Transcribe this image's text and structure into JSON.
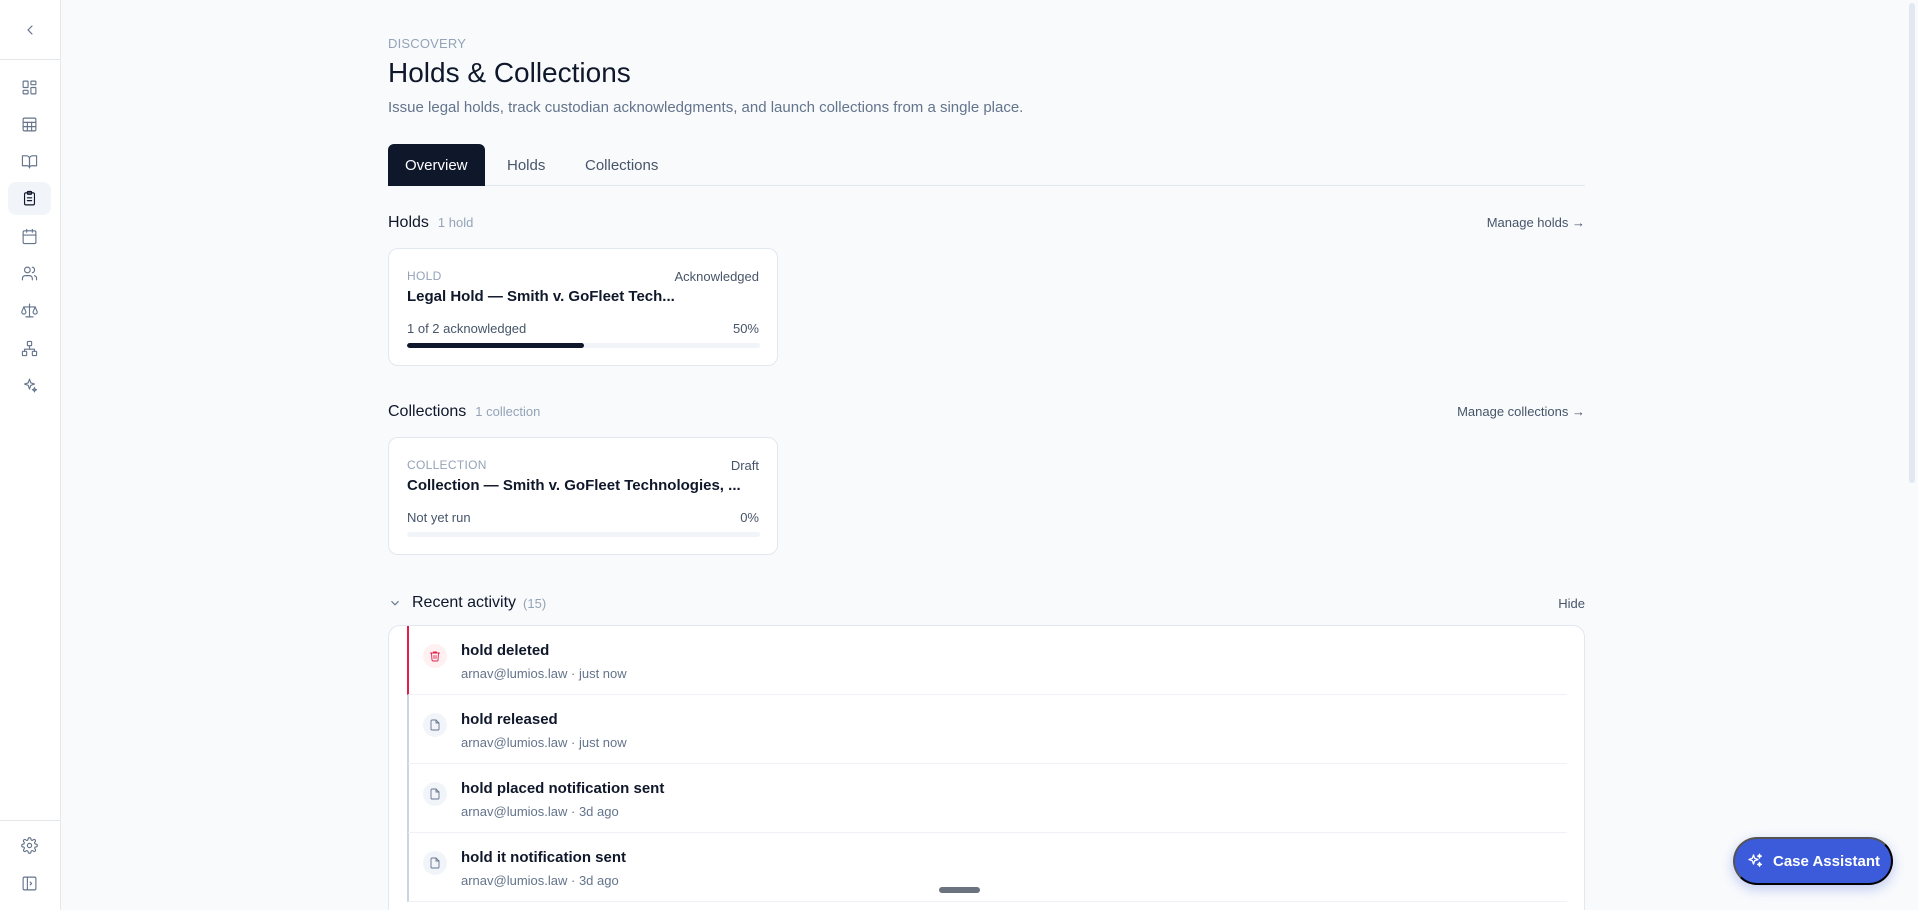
{
  "sidebar": {
    "collapse_icon": "chevron-left-icon",
    "items": [
      {
        "name": "dashboard",
        "icon": "layout-dashboard-icon"
      },
      {
        "name": "table",
        "icon": "table-icon"
      },
      {
        "name": "library",
        "icon": "book-open-icon"
      },
      {
        "name": "holds",
        "icon": "clipboard-icon",
        "active": true
      },
      {
        "name": "calendar",
        "icon": "calendar-icon"
      },
      {
        "name": "people",
        "icon": "users-icon"
      },
      {
        "name": "scales",
        "icon": "scale-icon"
      },
      {
        "name": "hierarchy",
        "icon": "network-icon"
      },
      {
        "name": "ai",
        "icon": "sparkles-icon"
      }
    ],
    "bottom": [
      {
        "name": "settings",
        "icon": "gear-icon"
      },
      {
        "name": "panel",
        "icon": "sidebar-panel-icon"
      }
    ]
  },
  "header": {
    "eyebrow": "DISCOVERY",
    "title": "Holds & Collections",
    "subtitle": "Issue legal holds, track custodian acknowledgments, and launch collections from a single place."
  },
  "tabs": [
    {
      "label": "Overview",
      "active": true
    },
    {
      "label": "Holds",
      "active": false
    },
    {
      "label": "Collections",
      "active": false
    }
  ],
  "holds_section": {
    "title": "Holds",
    "count": "1 hold",
    "link": "Manage holds →",
    "card": {
      "type": "HOLD",
      "status": "Acknowledged",
      "name": "Legal Hold — Smith v. GoFleet Tech...",
      "progress_label": "1 of 2 acknowledged",
      "progress_pct": "50%",
      "progress_value": 0.5
    }
  },
  "collections_section": {
    "title": "Collections",
    "count": "1 collection",
    "link": "Manage collections →",
    "card": {
      "type": "COLLECTION",
      "status": "Draft",
      "name": "Collection — Smith v. GoFleet Technologies, ...",
      "progress_label": "Not yet run",
      "progress_pct": "0%",
      "progress_value": 0
    }
  },
  "activity": {
    "title": "Recent activity",
    "count": "(15)",
    "hide_label": "Hide",
    "items": [
      {
        "title": "hold deleted",
        "meta": "arnav@lumios.law · just now",
        "icon": "trash-icon",
        "kind": "deleted"
      },
      {
        "title": "hold released",
        "meta": "arnav@lumios.law · just now",
        "icon": "file-icon",
        "kind": "normal"
      },
      {
        "title": "hold placed notification sent",
        "meta": "arnav@lumios.law · 3d ago",
        "icon": "file-icon",
        "kind": "normal"
      },
      {
        "title": "hold it notification sent",
        "meta": "arnav@lumios.law · 3d ago",
        "icon": "file-icon",
        "kind": "normal"
      }
    ]
  },
  "assistant": {
    "label": "Case Assistant",
    "icon": "sparkles-icon"
  },
  "colors": {
    "primary": "#0f172a",
    "accent": "#3b5bdb",
    "danger": "#e11d48"
  }
}
